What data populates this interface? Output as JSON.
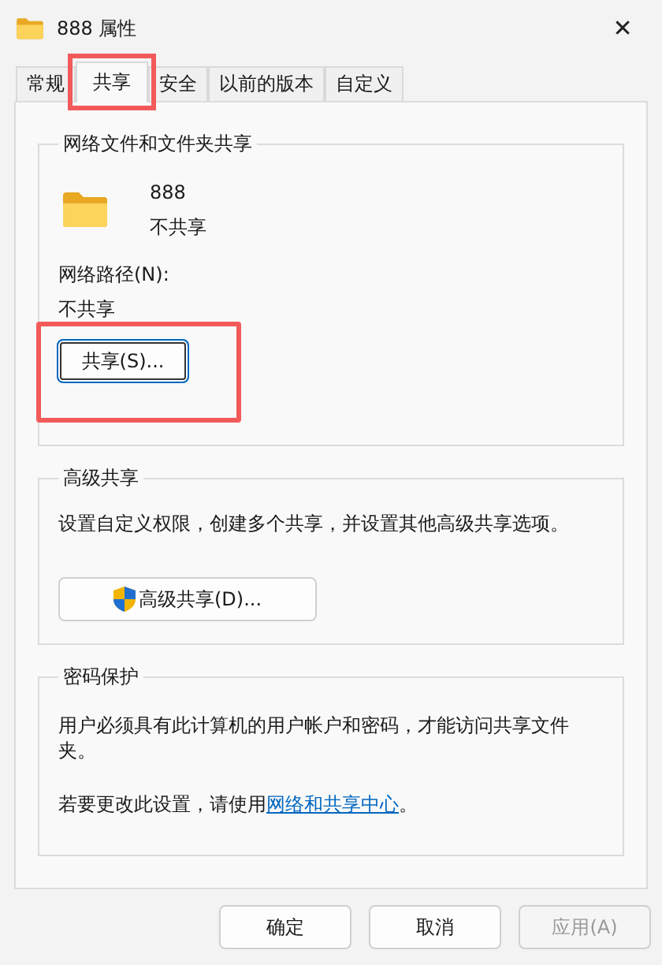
{
  "window": {
    "title": "888 属性",
    "close": "✕"
  },
  "tabs": [
    {
      "label": "常规",
      "selected": false,
      "highlighted": false
    },
    {
      "label": "共享",
      "selected": true,
      "highlighted": true
    },
    {
      "label": "安全",
      "selected": false,
      "highlighted": false
    },
    {
      "label": "以前的版本",
      "selected": false,
      "highlighted": false
    },
    {
      "label": "自定义",
      "selected": false,
      "highlighted": false
    }
  ],
  "network_sharing": {
    "legend": "网络文件和文件夹共享",
    "folder_name": "888",
    "folder_status": "不共享",
    "path_label": "网络路径(N):",
    "path_value": "不共享",
    "share_button": {
      "label": "共享(S)...",
      "highlighted": true,
      "focused": true
    }
  },
  "advanced_sharing": {
    "legend": "高级共享",
    "description": "设置自定义权限，创建多个共享，并设置其他高级共享选项。",
    "button": {
      "label": "高级共享(D)...",
      "shield": true
    }
  },
  "password_protection": {
    "legend": "密码保护",
    "description": "用户必须具有此计算机的用户帐户和密码，才能访问共享文件夹。",
    "hint_before": "若要更改此设置，请使用",
    "link": "网络和共享中心",
    "hint_after": "。"
  },
  "buttons": [
    {
      "label": "确定",
      "disabled": false
    },
    {
      "label": "取消",
      "disabled": false
    },
    {
      "label": "应用(A)",
      "disabled": true
    }
  ]
}
